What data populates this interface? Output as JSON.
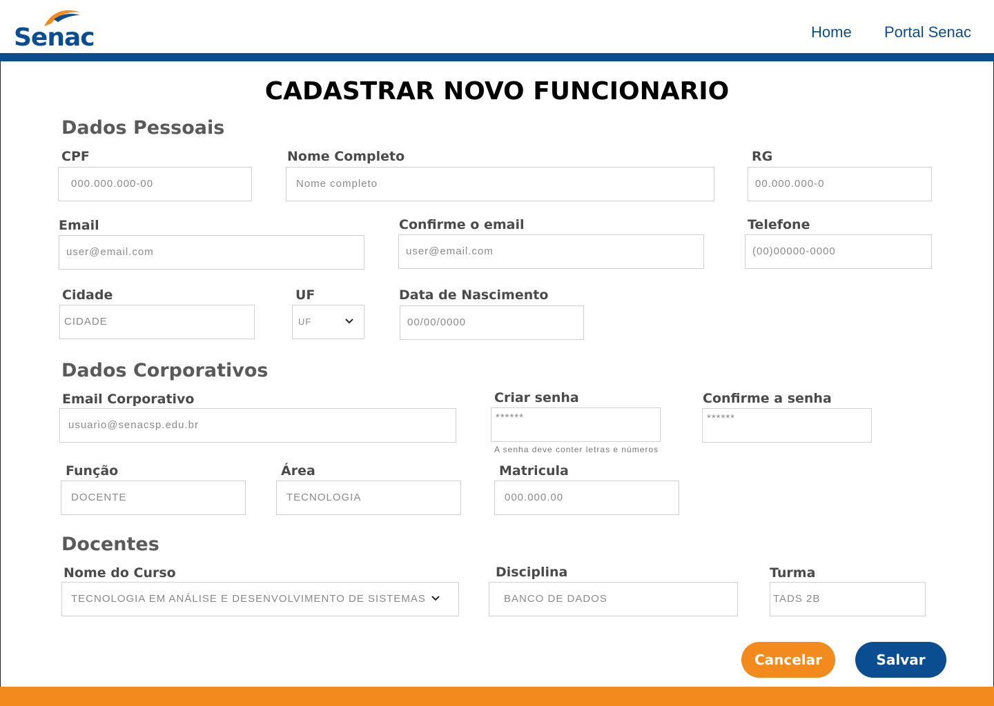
{
  "header": {
    "logo_text": "Senac",
    "nav": {
      "home": "Home",
      "portal": "Portal Senac"
    }
  },
  "page": {
    "title": "CADASTRAR NOVO FUNCIONARIO"
  },
  "sections": {
    "pessoais": "Dados Pessoais",
    "corporativos": "Dados Corporativos",
    "docentes": "Docentes"
  },
  "pessoais": {
    "cpf": {
      "label": "CPF",
      "placeholder": "000.000.000-00"
    },
    "nome": {
      "label": "Nome Completo",
      "placeholder": "Nome completo"
    },
    "rg": {
      "label": "RG",
      "placeholder": "00.000.000-0"
    },
    "email": {
      "label": "Email",
      "placeholder": "user@email.com"
    },
    "confirm_email": {
      "label": "Confirme o email",
      "placeholder": "user@email.com"
    },
    "telefone": {
      "label": "Telefone",
      "placeholder": "(00)00000-0000"
    },
    "cidade": {
      "label": "Cidade",
      "placeholder": "CIDADE"
    },
    "uf": {
      "label": "UF",
      "value": "UF"
    },
    "nascimento": {
      "label": "Data de Nascimento",
      "placeholder": "00/00/0000"
    }
  },
  "corporativos": {
    "email_corp": {
      "label": "Email Corporativo",
      "placeholder": "usuario@senacsp.edu.br"
    },
    "senha": {
      "label": "Criar senha",
      "placeholder": "******",
      "hint": "A senha deve conter letras e números"
    },
    "confirm_senha": {
      "label": "Confirme a senha",
      "placeholder": "******"
    },
    "funcao": {
      "label": "Função",
      "placeholder": "DOCENTE"
    },
    "area": {
      "label": "Área",
      "placeholder": "TECNOLOGIA"
    },
    "matricula": {
      "label": "Matricula",
      "placeholder": "000.000.00"
    }
  },
  "docentes": {
    "curso": {
      "label": "Nome do Curso",
      "value": "TECNOLOGIA EM ANÁLISE E DESENVOLVIMENTO DE SISTEMAS"
    },
    "disciplina": {
      "label": "Disciplina",
      "placeholder": "BANCO DE DADOS"
    },
    "turma": {
      "label": "Turma",
      "placeholder": "TADS 2B"
    }
  },
  "actions": {
    "cancel": "Cancelar",
    "save": "Salvar"
  },
  "colors": {
    "brand_blue": "#0b4d91",
    "brand_orange": "#f28a1d"
  }
}
